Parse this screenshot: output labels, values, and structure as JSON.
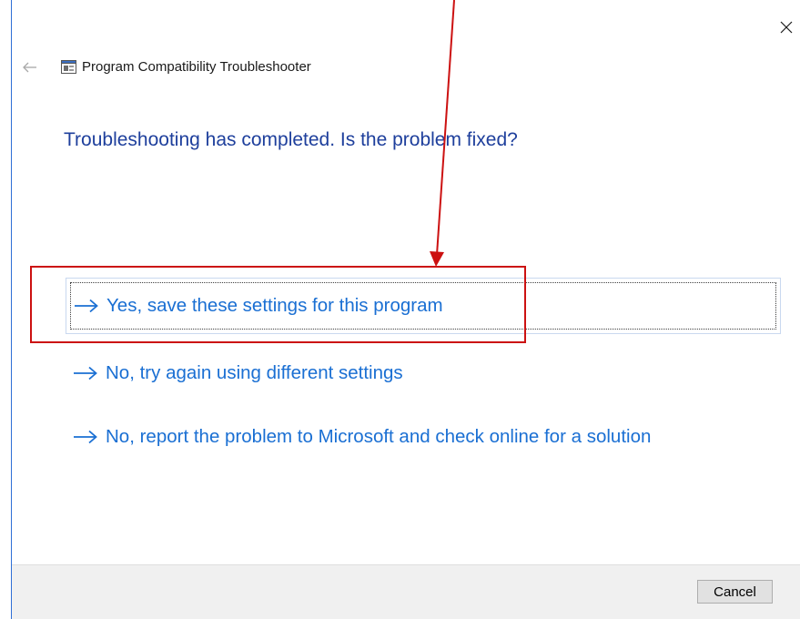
{
  "window": {
    "title": "Program Compatibility Troubleshooter",
    "close_glyph": "✕",
    "back_icon": "back-arrow-icon",
    "app_icon": "program-compatibility-icon"
  },
  "main": {
    "heading": "Troubleshooting has completed.  Is the problem fixed?",
    "options": [
      {
        "label": "Yes, save these settings for this program",
        "icon": "right-arrow-icon",
        "focused": true
      },
      {
        "label": "No, try again using different settings",
        "icon": "right-arrow-icon",
        "focused": false
      },
      {
        "label": "No, report the problem to Microsoft and check online for a solution",
        "icon": "right-arrow-icon",
        "focused": false
      }
    ]
  },
  "footer": {
    "cancel_label": "Cancel"
  },
  "annotation": {
    "color": "#cc1111",
    "target": "Yes, save these settings for this program"
  },
  "colors": {
    "heading": "#1e3f9c",
    "link": "#1a6fd3",
    "footer_bg": "#f0f0f0",
    "window_border": "#2f6fd6"
  }
}
